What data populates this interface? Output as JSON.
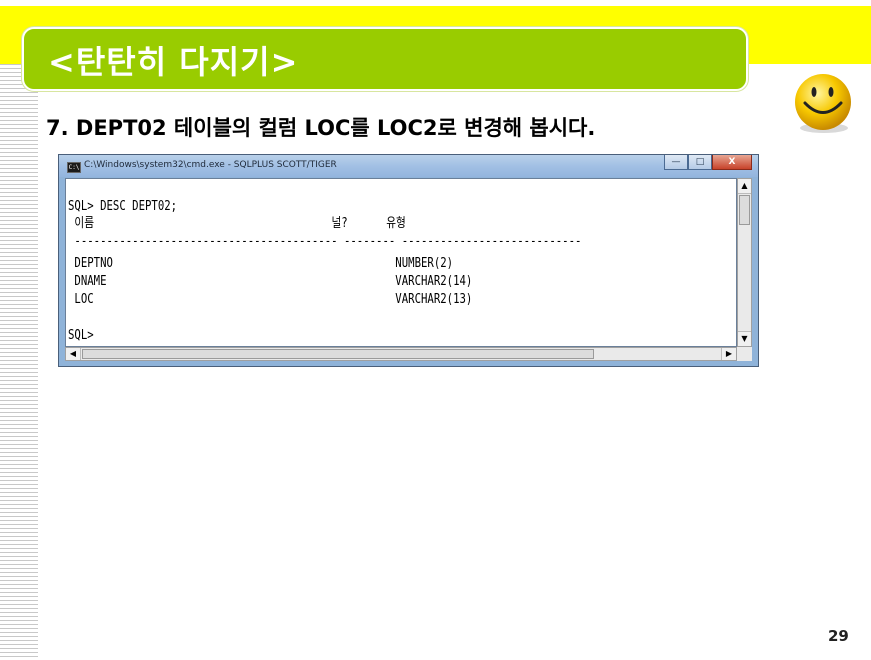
{
  "slide": {
    "title": "<탄탄히 다지기>",
    "question": "7. DEPT02 테이블의 컬럼 LOC를 LOC2로 변경해 봅시다.",
    "page_number": "29",
    "colors": {
      "top_band": "#ffff00",
      "title_box": "#99cc00"
    },
    "decoration": "smiley-face-icon"
  },
  "window": {
    "title": "C:\\Windows\\system32\\cmd.exe - SQLPLUS  SCOTT/TIGER",
    "buttons": {
      "minimize": "—",
      "maximize": "□",
      "close": "X"
    }
  },
  "console": {
    "prompt_command": "SQL> DESC DEPT02;",
    "header": " 이름                                     널?      유형",
    "separator": " ----------------------------------------- -------- ----------------------------",
    "rows": [
      " DEPTNO                                            NUMBER(2)",
      " DNAME                                             VARCHAR2(14)",
      " LOC                                               VARCHAR2(13)"
    ],
    "final_prompt": "SQL>"
  },
  "scrollbars": {
    "up": "▲",
    "down": "▼",
    "left": "◀",
    "right": "▶"
  }
}
